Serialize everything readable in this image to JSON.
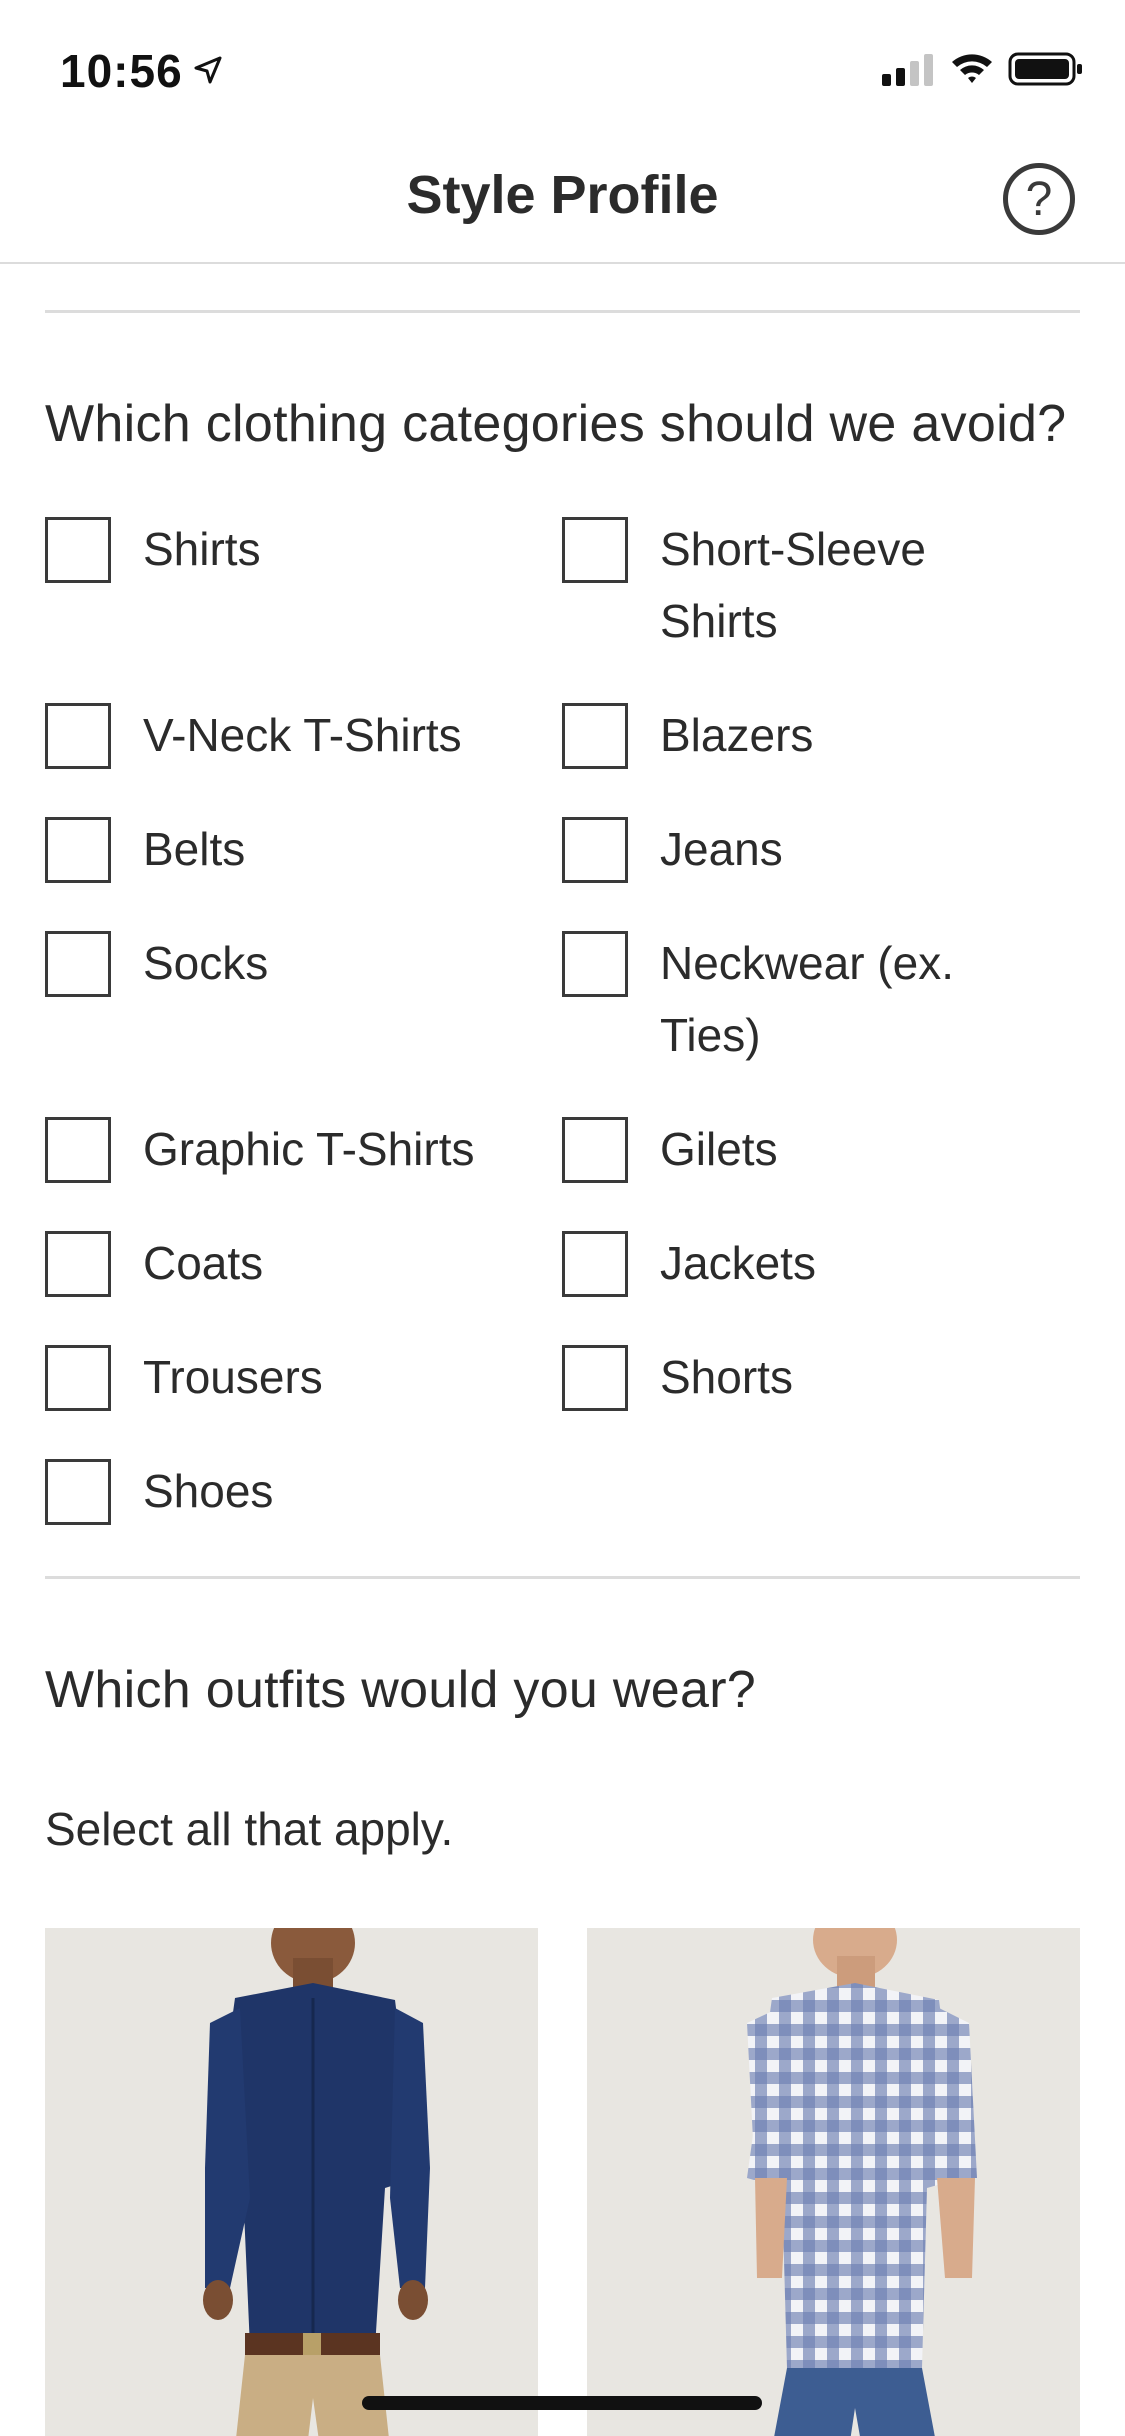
{
  "status_bar": {
    "time": "10:56"
  },
  "nav": {
    "title": "Style Profile",
    "help_label": "?"
  },
  "categories_section": {
    "title": "Which clothing categories should we avoid?",
    "left": [
      "Shirts",
      "V-Neck T-Shirts",
      "Belts",
      "Socks",
      "Graphic T-Shirts",
      "Coats",
      "Trousers",
      "Shoes"
    ],
    "right": [
      "Short-Sleeve Shirts",
      "Blazers",
      "Jeans",
      "Neckwear (ex. Ties)",
      "Gilets",
      "Jackets",
      "Shorts"
    ]
  },
  "outfits_section": {
    "title": "Which outfits would you wear?",
    "helper": "Select all that apply."
  },
  "colors": {
    "text": "#2b2b2b",
    "divider": "#dcdcdc",
    "card_bg": "#e9e7e3"
  }
}
